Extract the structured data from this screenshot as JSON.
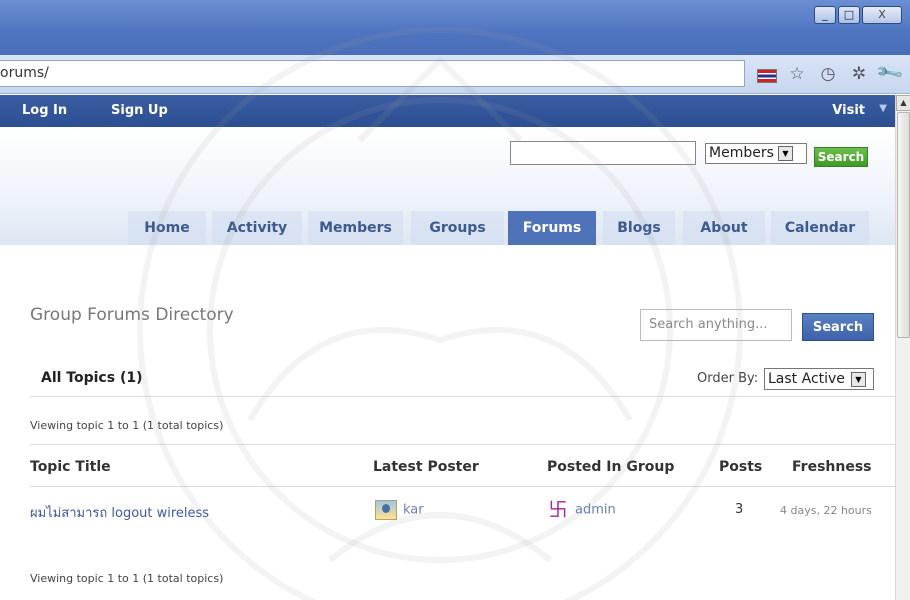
{
  "browser": {
    "window_controls": [
      "_",
      "□",
      "X"
    ],
    "url": "orums/",
    "toolbar_icons": [
      "flag-icon",
      "star-icon",
      "globe-icon",
      "gear-icon",
      "wrench-icon"
    ]
  },
  "adminbar": {
    "login": "Log In",
    "signup": "Sign Up",
    "visit": "Visit"
  },
  "header": {
    "search_value": "",
    "select_value": "Members",
    "search_button": "Search"
  },
  "nav": {
    "tabs": [
      {
        "label": "Home"
      },
      {
        "label": "Activity"
      },
      {
        "label": "Members"
      },
      {
        "label": "Groups"
      },
      {
        "label": "Forums"
      },
      {
        "label": "Blogs"
      },
      {
        "label": "About"
      },
      {
        "label": "Calendar"
      }
    ],
    "active": "Forums"
  },
  "content": {
    "page_title": "Group Forums Directory",
    "search_placeholder": "Search anything...",
    "search_button": "Search",
    "all_topics": "All Topics (1)",
    "order_by_label": "Order By:",
    "order_by_value": "Last Active",
    "viewing_top": "Viewing topic 1 to 1 (1 total topics)",
    "viewing_bottom": "Viewing topic 1 to 1 (1 total topics)",
    "columns": [
      "Topic Title",
      "Latest Poster",
      "Posted In Group",
      "Posts",
      "Freshness"
    ],
    "rows": [
      {
        "topic": "ผมไม่สามารถ logout wireless",
        "latest_poster": "kar",
        "group": "admin",
        "posts": "3",
        "freshness": "4 days, 22 hours"
      }
    ]
  },
  "colors": {
    "nav_active": "#4f73b8",
    "adminbar": "#3b5ea3",
    "header_search_button": "#3f9a25",
    "link": "#3d5a9c"
  }
}
